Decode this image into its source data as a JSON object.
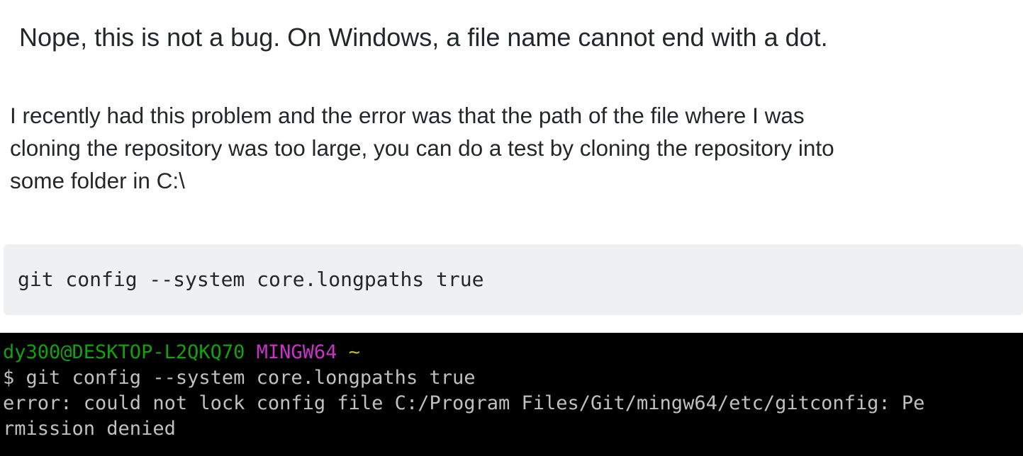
{
  "answer_heading": "Nope, this is not a bug. On Windows, a file name cannot end with a dot.",
  "answer_paragraph_lines": [
    "I recently had this problem and the error was that the path of the file where I was",
    "cloning the repository was too large, you can do a test by cloning the repository into",
    "some folder in C:\\"
  ],
  "code_block": "git config --system core.longpaths true",
  "terminal": {
    "prompt_user": "dy300@DESKTOP-L2QKQ70",
    "prompt_env": "MINGW64",
    "prompt_dir": "~",
    "command": "$ git config --system core.longpaths true",
    "error_lines": [
      "error: could not lock config file C:/Program Files/Git/mingw64/etc/gitconfig: Pe",
      "rmission denied"
    ],
    "colors": {
      "background": "#000000",
      "user": "#13a10e",
      "env": "#c833c8",
      "dir": "#c1c100",
      "text": "#c0c0c0"
    }
  }
}
